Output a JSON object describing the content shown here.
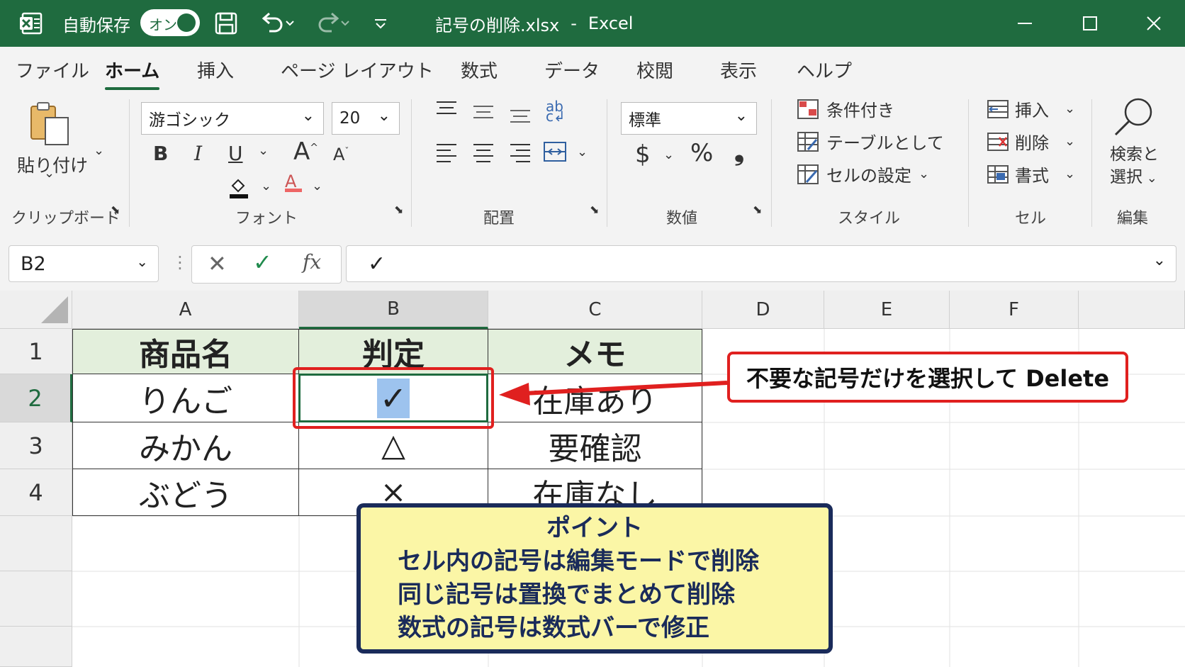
{
  "titlebar": {
    "autosave_label": "自動保存",
    "autosave_state": "オン",
    "filename": "記号の削除.xlsx",
    "separator": "-",
    "app": "Excel"
  },
  "tabs": [
    "ファイル",
    "ホーム",
    "挿入",
    "ページ レイアウト",
    "数式",
    "データ",
    "校閲",
    "表示",
    "ヘルプ"
  ],
  "ribbon": {
    "paste_label": "貼り付け",
    "clipboard_label": "クリップボード",
    "font_name": "游ゴシック",
    "font_size": "20",
    "bold": "B",
    "italic": "I",
    "underline": "U",
    "font_label": "フォント",
    "align_label": "配置",
    "number_format": "標準",
    "currency": "$",
    "percent": "%",
    "comma": "❟",
    "number_label": "数値",
    "cond_format": "条件付き",
    "as_table": "テーブルとして",
    "cell_styles": "セルの設定",
    "styles_label": "スタイル",
    "insert": "挿入",
    "delete": "削除",
    "format": "書式",
    "cells_label": "セル",
    "find_line1": "検索と",
    "find_line2": "選択",
    "edit_label": "編集"
  },
  "formula_bar": {
    "name_box": "B2",
    "fx": "fx",
    "content": "✓"
  },
  "columns": [
    "A",
    "B",
    "C",
    "D",
    "E",
    "F"
  ],
  "rows": [
    "1",
    "2",
    "3",
    "4"
  ],
  "table": {
    "headers": [
      "商品名",
      "判定",
      "メモ"
    ],
    "rows": [
      [
        "りんご",
        "✓",
        "在庫あり"
      ],
      [
        "みかん",
        "△",
        "要確認"
      ],
      [
        "ぶどう",
        "×",
        "在庫なし"
      ]
    ]
  },
  "callout": "不要な記号だけを選択して Delete",
  "note": {
    "title": "ポイント",
    "lines": [
      "セル内の記号は編集モードで削除",
      "同じ記号は置換でまとめて削除",
      "数式の記号は数式バーで修正"
    ]
  },
  "colors": {
    "excel_green": "#1f6b3f",
    "callout_red": "#e0201f",
    "note_bg": "#fbf6a6",
    "note_border": "#1a2b5a",
    "selection_blue": "#9dc3ee"
  }
}
